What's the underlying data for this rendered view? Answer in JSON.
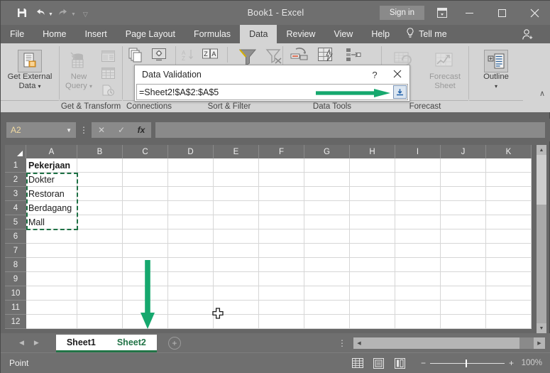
{
  "window": {
    "title": "Book1  -  Excel",
    "signin_label": "Sign in",
    "quick_access": [
      "save-icon",
      "undo-icon",
      "redo-icon",
      "customize-qat-icon"
    ],
    "ribbon_display_icon": "ribbon-display-options-icon",
    "minimize_icon": "minimize-icon",
    "maximize_icon": "maximize-icon",
    "close_icon": "close-icon"
  },
  "tabs": {
    "items": [
      "File",
      "Home",
      "Insert",
      "Page Layout",
      "Formulas",
      "Data",
      "Review",
      "View",
      "Help"
    ],
    "active": "Data",
    "tell_me": "Tell me",
    "account_icon": "account-person-icon"
  },
  "ribbon": {
    "groups": [
      {
        "label": "",
        "buttons": [
          {
            "label_line1": "Get External",
            "label_line2": "Data",
            "caret": "▾",
            "icon": "get-external-data-icon"
          }
        ]
      },
      {
        "label": "Get & Transform",
        "buttons": [
          {
            "label_line1": "New",
            "label_line2": "Query",
            "caret": "▾",
            "icon": "new-query-icon"
          }
        ]
      },
      {
        "label": "Connections",
        "buttons": []
      },
      {
        "label": "Sort & Filter",
        "buttons": []
      },
      {
        "label": "Data Tools",
        "buttons": []
      },
      {
        "label": "Forecast",
        "buttons": [
          {
            "label_line1": "Forecast",
            "label_line2": "Sheet",
            "caret": "",
            "icon": "forecast-sheet-icon"
          }
        ]
      },
      {
        "label": "",
        "buttons": [
          {
            "label_line1": "Outline",
            "label_line2": "",
            "caret": "▾",
            "icon": "outline-icon"
          }
        ]
      }
    ],
    "collapse_icon": "∧"
  },
  "dialog": {
    "title": "Data Validation",
    "help_label": "?",
    "close_label": "✕",
    "range_value": "=Sheet2!$A$2:$A$5",
    "range_placeholder": "",
    "collapse_button_icon": "collapse-dialog-icon"
  },
  "formula_bar": {
    "name_box": "A2",
    "name_box_caret": "▾",
    "cancel_icon": "✕",
    "confirm_icon": "✓",
    "fx_label": "fx",
    "formula_value": "",
    "formula_placeholder": ""
  },
  "grid": {
    "columns": [
      "A",
      "B",
      "C",
      "D",
      "E",
      "F",
      "G",
      "H",
      "I",
      "J",
      "K"
    ],
    "rows": [
      "1",
      "2",
      "3",
      "4",
      "5",
      "6",
      "7",
      "8",
      "9",
      "10",
      "11",
      "12"
    ],
    "cells": {
      "A1": "Pekerjaan",
      "A2": "Dokter",
      "A3": "Restoran",
      "A4": "Berdagang",
      "A5": "Mall"
    },
    "selection_range": "A2:A5",
    "selection_color": "#1e7145"
  },
  "sheet_tabs": {
    "prev_icon": "◀",
    "next_icon": "▶",
    "items": [
      {
        "label": "Sheet1",
        "active": false
      },
      {
        "label": "Sheet2",
        "active": true
      }
    ],
    "add_label": "+"
  },
  "status_bar": {
    "mode": "Point",
    "views": [
      "normal-view-icon",
      "page-layout-view-icon",
      "page-break-preview-icon"
    ],
    "zoom_out": "−",
    "zoom_in": "+",
    "zoom_level": "100%"
  },
  "annotations": {
    "arrow_color": "#16a86e",
    "arrow_to_collapse_button": "arrow-pointing-to-collapse-dialog-button",
    "arrow_to_sheet2": "arrow-pointing-to-sheet2-tab",
    "cell_cursor": "excel-cross-cursor"
  }
}
